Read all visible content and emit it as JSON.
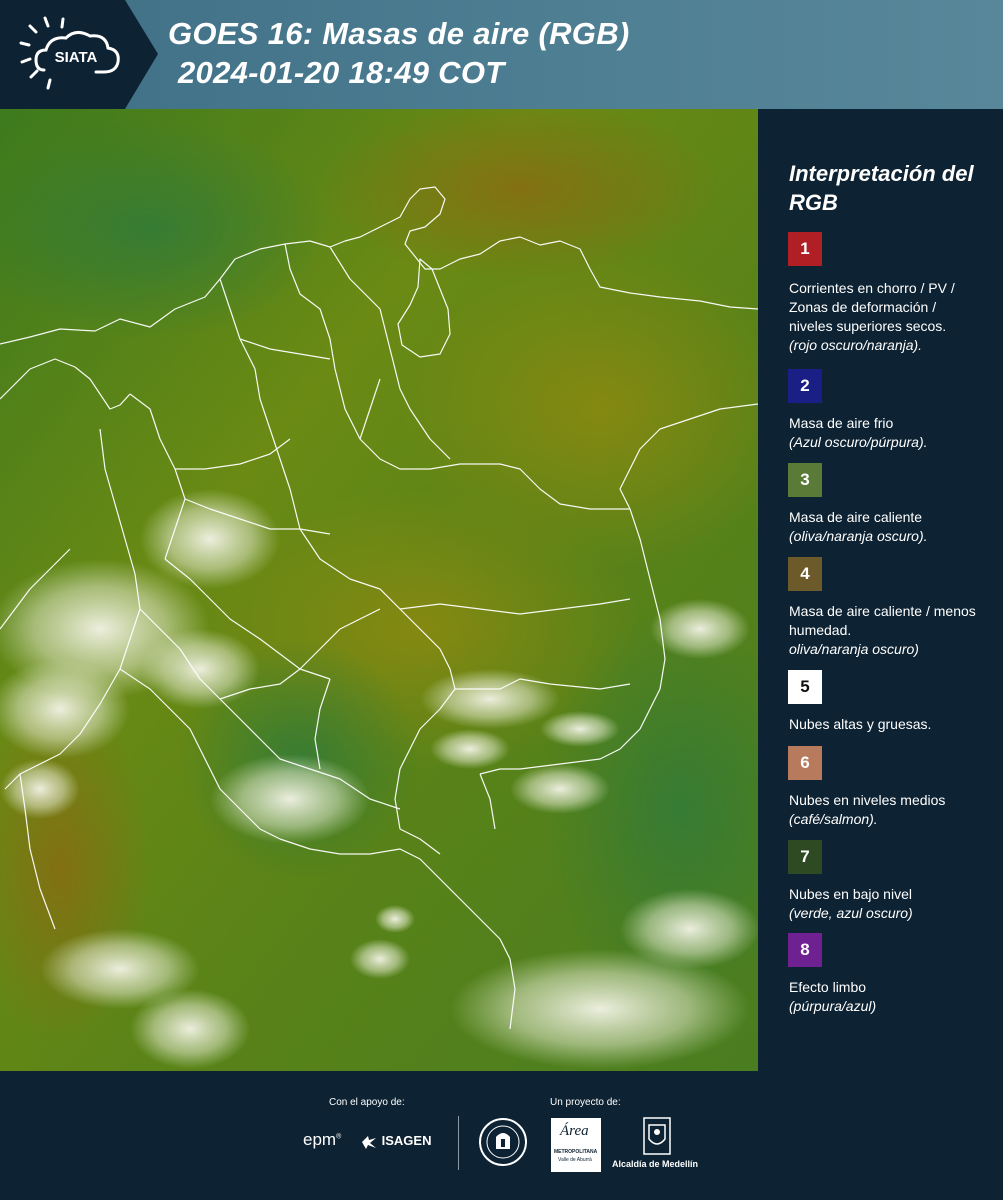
{
  "header": {
    "logo_text": "SIATA",
    "title_line1": "GOES 16: Masas de aire (RGB)",
    "title_line2": "2024-01-20 18:49 COT"
  },
  "legend": {
    "title": "Interpretación del RGB",
    "items": [
      {
        "number": "1",
        "color": "#b01f24",
        "text": "Corrientes en chorro / PV / Zonas de deformación / niveles superiores secos.",
        "note": "(rojo oscuro/naranja)."
      },
      {
        "number": "2",
        "color": "#1a1f86",
        "text": "Masa de aire frio",
        "note": "(Azul oscuro/púrpura)."
      },
      {
        "number": "3",
        "color": "#5a7b37",
        "text": "Masa de aire caliente",
        "note": "(oliva/naranja oscuro)."
      },
      {
        "number": "4",
        "color": "#6d5a2a",
        "text": "Masa de aire caliente / menos humedad.",
        "note": "oliva/naranja oscuro)"
      },
      {
        "number": "5",
        "color": "#ffffff",
        "text": "Nubes altas y gruesas.",
        "note": ""
      },
      {
        "number": "6",
        "color": "#b87a5c",
        "text": "Nubes en niveles medios",
        "note": "(café/salmon)."
      },
      {
        "number": "7",
        "color": "#2d4a22",
        "text": "Nubes en bajo nivel",
        "note": "(verde, azul oscuro)"
      },
      {
        "number": "8",
        "color": "#6f2191",
        "text": "Efecto limbo",
        "note": "(púrpura/azul)"
      }
    ]
  },
  "footer": {
    "support_label": "Con el apoyo de:",
    "project_label": "Un proyecto de:",
    "logo_epm": "epm",
    "logo_isagen": "ISAGEN",
    "logo_area_name": "Área",
    "logo_area_sub": "METROPOLITANA",
    "logo_area_sub2": "Valle de Aburrá",
    "logo_alcaldia": "Alcaldía de Medellín"
  }
}
